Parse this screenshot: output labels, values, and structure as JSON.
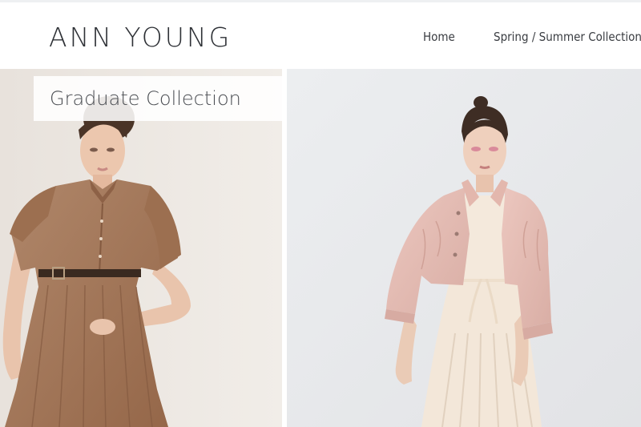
{
  "header": {
    "brand": "ANN YOUNG",
    "nav": [
      {
        "label": "Home"
      },
      {
        "label": "Spring / Summer Collection"
      }
    ]
  },
  "gallery": {
    "left": {
      "caption": "Graduate Collection",
      "photo": "model-in-brown-shirt-dress",
      "palette": {
        "background": "#ece6df",
        "dress": "#a6795a",
        "skin": "#e9c4ac",
        "hair": "#4a3427"
      }
    },
    "right": {
      "photo": "model-in-pink-jacket-and-cream-dress",
      "palette": {
        "background": "#e7e8ea",
        "jacket": "#e6bdb4",
        "dress": "#f2e6d8",
        "skin": "#eacbb6",
        "hair": "#3e2d24"
      }
    }
  }
}
